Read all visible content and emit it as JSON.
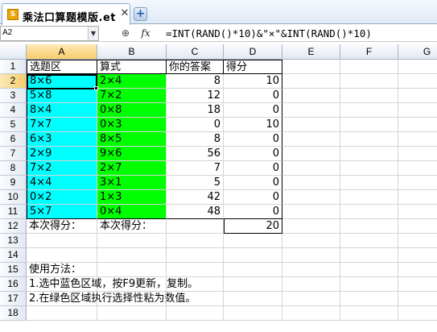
{
  "tab": {
    "icon_text": "S",
    "title": "乘法口算题模版.et",
    "close_glyph": "✕",
    "add_glyph": "+"
  },
  "formula_bar": {
    "cell_ref": "A2",
    "dropdown_glyph": "▼",
    "zoom_glyph": "⊕",
    "fx_label": "fx",
    "formula": "=INT(RAND()*10)&\"×\"&INT(RAND()*10)"
  },
  "columns": [
    "A",
    "B",
    "C",
    "D",
    "E",
    "F",
    "G",
    "H"
  ],
  "rows": [
    "1",
    "2",
    "3",
    "4",
    "5",
    "6",
    "7",
    "8",
    "9",
    "10",
    "11",
    "12",
    "13",
    "14",
    "15",
    "16",
    "17",
    "18"
  ],
  "headers": {
    "a1": "选题区",
    "b1": "算式",
    "c1": "你的答案",
    "d1": "得分"
  },
  "problems": [
    {
      "question": "8×6",
      "formula": "2×4",
      "answer": "8",
      "score": "10"
    },
    {
      "question": "5×8",
      "formula": "7×2",
      "answer": "12",
      "score": "0"
    },
    {
      "question": "8×4",
      "formula": "0×8",
      "answer": "18",
      "score": "0"
    },
    {
      "question": "7×7",
      "formula": "0×3",
      "answer": "0",
      "score": "10"
    },
    {
      "question": "6×3",
      "formula": "8×5",
      "answer": "8",
      "score": "0"
    },
    {
      "question": "2×9",
      "formula": "9×6",
      "answer": "56",
      "score": "0"
    },
    {
      "question": "7×2",
      "formula": "2×7",
      "answer": "7",
      "score": "0"
    },
    {
      "question": "4×4",
      "formula": "3×1",
      "answer": "5",
      "score": "0"
    },
    {
      "question": "0×2",
      "formula": "1×3",
      "answer": "42",
      "score": "0"
    },
    {
      "question": "5×7",
      "formula": "0×4",
      "answer": "48",
      "score": "0"
    }
  ],
  "totals": {
    "a12": "本次得分：",
    "b12": "本次得分：",
    "d12": "20"
  },
  "instructions": {
    "title": "使用方法：",
    "step1": "1.选中蓝色区域，按F9更新，复制。",
    "step2": "2.在绿色区域执行选择性粘为数值。"
  }
}
